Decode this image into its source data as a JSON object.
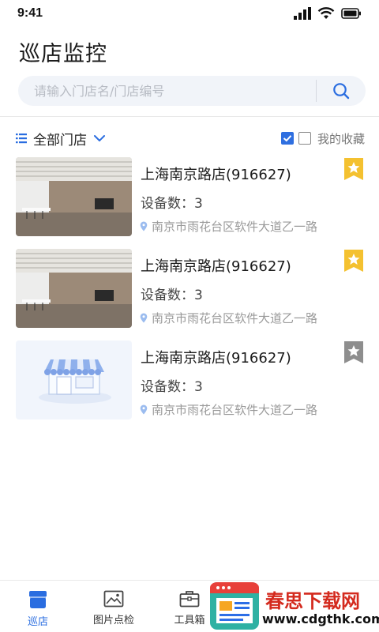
{
  "status_bar": {
    "time": "9:41"
  },
  "header": {
    "title": "巡店监控"
  },
  "search": {
    "placeholder": "请输入门店名/门店编号",
    "value": ""
  },
  "filter": {
    "all_stores_label": "全部门店",
    "favorites_label": "我的收藏",
    "favorites_checked": false
  },
  "stores": [
    {
      "name": "上海南京路店(916627)",
      "devices": "设备数：3",
      "address": "南京市雨花台区软件大道乙一路",
      "favorited": true,
      "thumb": "store-photo"
    },
    {
      "name": "上海南京路店(916627)",
      "devices": "设备数：3",
      "address": "南京市雨花台区软件大道乙一路",
      "favorited": true,
      "thumb": "store-photo"
    },
    {
      "name": "上海南京路店(916627)",
      "devices": "设备数：3",
      "address": "南京市雨花台区软件大道乙一路",
      "favorited": false,
      "thumb": "store-placeholder"
    }
  ],
  "tab_bar": {
    "tabs": [
      {
        "label": "巡店",
        "icon": "store-icon",
        "active": true
      },
      {
        "label": "图片点检",
        "icon": "image-icon",
        "active": false
      },
      {
        "label": "工具箱",
        "icon": "toolbox-icon",
        "active": false
      }
    ]
  },
  "watermark": {
    "title": "春思下载网",
    "url": "www.cdgthk.com"
  },
  "colors": {
    "accent": "#2a6de0",
    "favorite": "#f4c130",
    "favorite_off": "#8e8e8e",
    "search_bg": "#f1f4f9"
  }
}
